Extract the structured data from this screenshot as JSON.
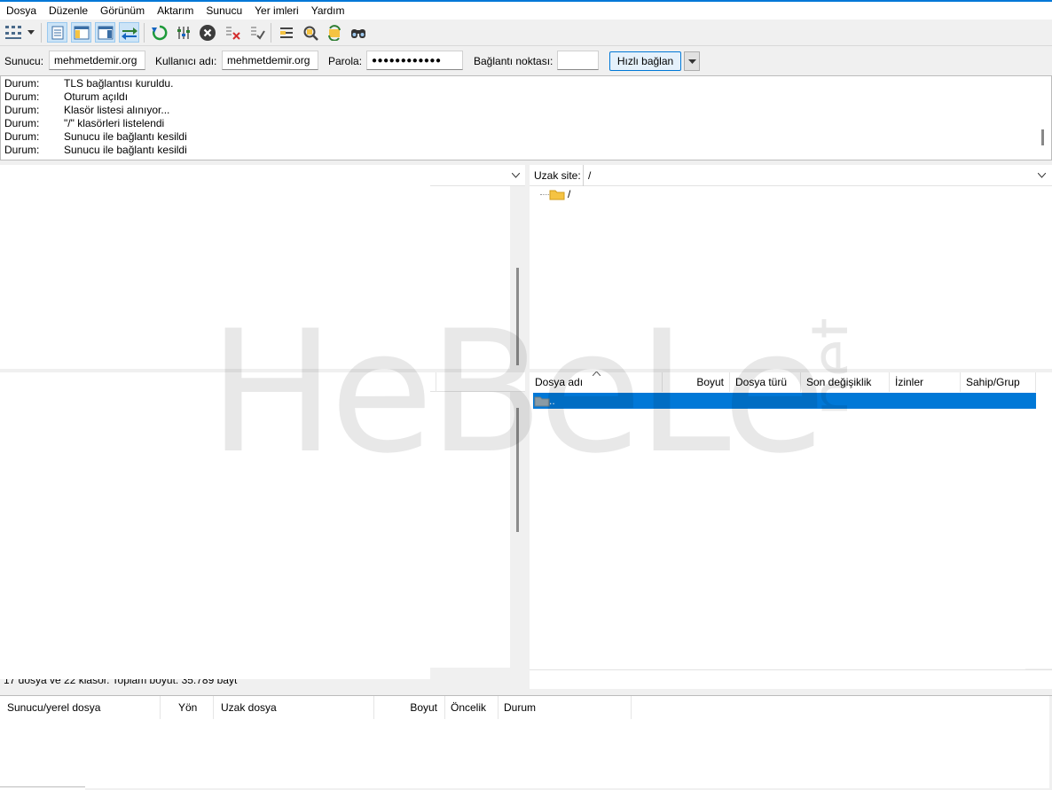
{
  "menu": [
    "Dosya",
    "Düzenle",
    "Görünüm",
    "Aktarım",
    "Sunucu",
    "Yer imleri",
    "Yardım"
  ],
  "quickconnect": {
    "host_label": "Sunucu:",
    "host_value": "mehmetdemir.org",
    "user_label": "Kullanıcı adı:",
    "user_value": "mehmetdemir.org",
    "pass_label": "Parola:",
    "pass_value": "●●●●●●●●●●●●",
    "port_label": "Bağlantı noktası:",
    "port_value": "",
    "connect_label": "Hızlı bağlan"
  },
  "log": [
    {
      "k": "Durum:",
      "v": "TLS bağlantısı kuruldu."
    },
    {
      "k": "Durum:",
      "v": "Oturum açıldı"
    },
    {
      "k": "Durum:",
      "v": "Klasör listesi alınıyor..."
    },
    {
      "k": "Durum:",
      "v": "\"/\" klasörleri listelendi"
    },
    {
      "k": "Durum:",
      "v": "Sunucu ile bağlantı kesildi"
    },
    {
      "k": "Durum:",
      "v": "Sunucu ile bağlantı kesildi"
    }
  ],
  "remote": {
    "site_label": "Uzak site:",
    "site_value": "/",
    "tree_root": "/",
    "columns": [
      "Dosya adı",
      "Boyut",
      "Dosya türü",
      "Son değişiklik",
      "İzinler",
      "Sahip/Grup"
    ],
    "rows": [
      {
        "name": ".."
      }
    ]
  },
  "local": {
    "status": "17 dosya ve 22 klasör. Toplam boyut: 35.789 bayt"
  },
  "queue": {
    "columns": [
      "Sunucu/yerel dosya",
      "Yön",
      "Uzak dosya",
      "Boyut",
      "Öncelik",
      "Durum"
    ]
  },
  "watermark": "HeBeLe.net",
  "colors": {
    "accent": "#0078d7",
    "selection": "#0078d7",
    "folder": "#f5c342"
  }
}
